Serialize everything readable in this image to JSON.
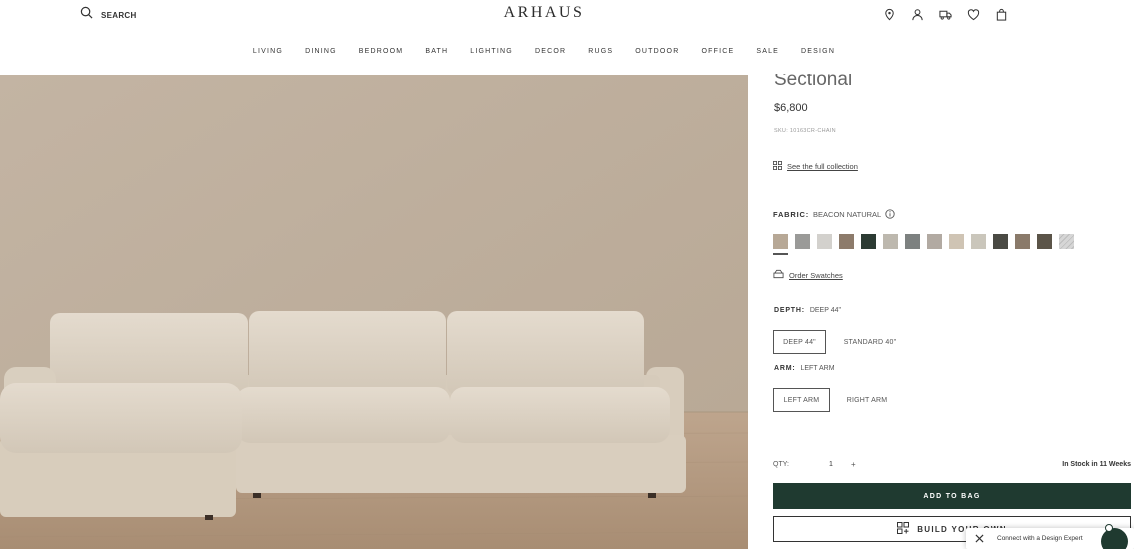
{
  "header": {
    "search_label": "SEARCH",
    "logo": "ARHAUS",
    "icons": [
      "location-icon",
      "account-icon",
      "delivery-truck-icon",
      "wishlist-heart-icon",
      "shopping-bag-icon"
    ]
  },
  "nav": {
    "items": [
      {
        "label": "LIVING"
      },
      {
        "label": "DINING"
      },
      {
        "label": "BEDROOM"
      },
      {
        "label": "BATH"
      },
      {
        "label": "LIGHTING"
      },
      {
        "label": "DECOR"
      },
      {
        "label": "RUGS"
      },
      {
        "label": "OUTDOOR"
      },
      {
        "label": "OFFICE"
      },
      {
        "label": "SALE"
      },
      {
        "label": "DESIGN"
      }
    ]
  },
  "product": {
    "title": "Sectional",
    "price": "$6,800",
    "sku": "SKU: 10163CR-CHAIN",
    "collection_link": "See the full collection",
    "fabric": {
      "label": "FABRIC:",
      "value": "BEACON NATURAL",
      "swatch_colors": [
        "#b7a896",
        "#9a9a98",
        "#d3d1cd",
        "#8d7b6b",
        "#2c3b33",
        "#bdb8ae",
        "#7d8180",
        "#b2aaa2",
        "#cfc4b4",
        "#cac6bb",
        "#4a4a44",
        "#8a7a6a",
        "#5b5448",
        "#c9c9c9"
      ],
      "selected_index": 0
    },
    "order_swatches": "Order Swatches",
    "depth": {
      "label": "DEPTH:",
      "value": "DEEP 44\"",
      "options": [
        "DEEP 44\"",
        "STANDARD 40\""
      ]
    },
    "arm": {
      "label": "ARM:",
      "value": "LEFT ARM",
      "options": [
        "LEFT ARM",
        "RIGHT ARM"
      ]
    },
    "qty_label": "QTY:",
    "qty_value": "1",
    "qty_plus": "+",
    "stock": "In Stock in 11 Weeks",
    "add_to_bag": "ADD TO BAG",
    "build_your_own": "BUILD YOUR OWN"
  },
  "chat": {
    "text": "Connect with a Design Expert"
  },
  "colors": {
    "accent": "#1f3a30",
    "wall": "#c0b09e",
    "floor": "#b39a82",
    "sofa": "#ddd3c5"
  }
}
